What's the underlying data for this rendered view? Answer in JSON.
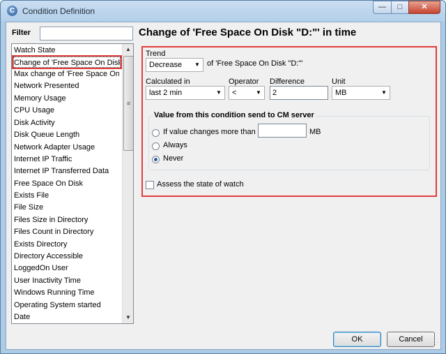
{
  "window": {
    "title": "Condition Definition",
    "app_icon_letter": "C",
    "minimize": "—",
    "maximize": "□",
    "close": "✕"
  },
  "filter": {
    "label": "Filter",
    "value": ""
  },
  "list": {
    "items": [
      "Watch State",
      "Change of 'Free Space On Disk ''",
      "Max change of 'Free Space On D",
      "Network Presented",
      "Memory Usage",
      "CPU Usage",
      "Disk Activity",
      "Disk Queue Length",
      "Network Adapter Usage",
      "Internet IP Traffic",
      "Internet IP Transferred Data",
      "Free Space On Disk",
      "Exists File",
      "File Size",
      "Files Size in Directory",
      "Files Count in Directory",
      "Exists Directory",
      "Directory Accessible",
      "LoggedOn User",
      "User Inactivity Time",
      "Windows Running Time",
      "Operating System started",
      "Date"
    ],
    "selected_index": 1
  },
  "heading": "Change of 'Free Space On Disk \"D:\"' in time",
  "trend": {
    "label": "Trend",
    "value": "Decrease",
    "suffix": "of 'Free Space On Disk \"D:\"'"
  },
  "calculated_in": {
    "label": "Calculated in",
    "value": "last 2 min"
  },
  "operator": {
    "label": "Operator",
    "value": "<"
  },
  "difference": {
    "label": "Difference",
    "value": "2"
  },
  "unit": {
    "label": "Unit",
    "value": "MB"
  },
  "send_group": {
    "title": "Value from this condition send to CM server",
    "option_changes": "If value changes more than",
    "changes_value": "",
    "changes_unit": "MB",
    "option_always": "Always",
    "option_never": "Never",
    "selected": "Never"
  },
  "assess": {
    "label": "Assess the state of watch",
    "checked": false
  },
  "buttons": {
    "ok": "OK",
    "cancel": "Cancel"
  },
  "colors": {
    "highlight_border": "#e23d3d",
    "selection": "#e23d3d"
  }
}
